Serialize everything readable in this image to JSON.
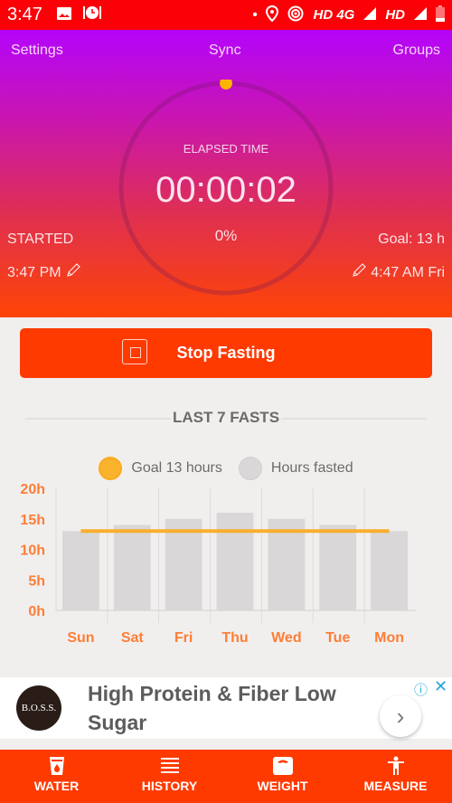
{
  "status_bar": {
    "time": "3:47",
    "network_text_1": "HD 4G",
    "network_text_2": "HD",
    "icons": [
      "image-icon",
      "alarm-food-icon",
      "dot-icon",
      "location-icon",
      "hotspot-icon",
      "signal-icon",
      "signal-icon",
      "battery-icon"
    ]
  },
  "topnav": {
    "settings": "Settings",
    "sync": "Sync",
    "groups": "Groups"
  },
  "timer": {
    "elapsed_label": "ELAPSED TIME",
    "elapsed_time": "00:00:02",
    "progress_text": "0%",
    "progress_fraction": 0.0,
    "started_label": "STARTED",
    "started_value": "3:47 PM",
    "goal_label": "Goal: 13 h",
    "goal_end_value": "4:47 AM Fri"
  },
  "colors": {
    "accent": "#ff3a00",
    "status_bar": "#fb0007",
    "goal_line": "#f9ae2c",
    "bar_fill": "#d9d7d7",
    "axis_label": "#fd7e36",
    "ad_info": "#23a6d9"
  },
  "actions": {
    "stop_label": "Stop Fasting"
  },
  "section": {
    "title": "LAST 7 FASTS"
  },
  "chart_data": {
    "type": "bar",
    "title": "LAST 7 FASTS",
    "categories": [
      "Sun",
      "Sat",
      "Fri",
      "Thu",
      "Wed",
      "Tue",
      "Mon"
    ],
    "series": [
      {
        "name": "Hours fasted",
        "values": [
          13,
          14,
          15,
          16,
          15,
          14,
          13
        ]
      }
    ],
    "goal_line": {
      "name": "Goal 13 hours",
      "value": 13
    },
    "legend": [
      {
        "label": "Goal 13 hours",
        "color": "#f9ae2c"
      },
      {
        "label": "Hours fasted",
        "color": "#d9d7d7"
      }
    ],
    "legend_position": "top-center",
    "yticks": [
      "0h",
      "5h",
      "10h",
      "15h",
      "20h"
    ],
    "ylim": [
      0,
      20
    ],
    "xlabel": "",
    "ylabel": "",
    "grid": "vertical"
  },
  "ad": {
    "logo_text": "B.O.S.S.",
    "headline": "High Protein & Fiber Low Sugar",
    "arrow": "›",
    "info": "ⓘ",
    "close": "✕"
  },
  "bottom_nav": [
    {
      "label": "WATER",
      "icon": "water-glass-icon"
    },
    {
      "label": "HISTORY",
      "icon": "list-icon"
    },
    {
      "label": "WEIGHT",
      "icon": "scale-icon"
    },
    {
      "label": "MEASURE",
      "icon": "person-measure-icon"
    }
  ]
}
